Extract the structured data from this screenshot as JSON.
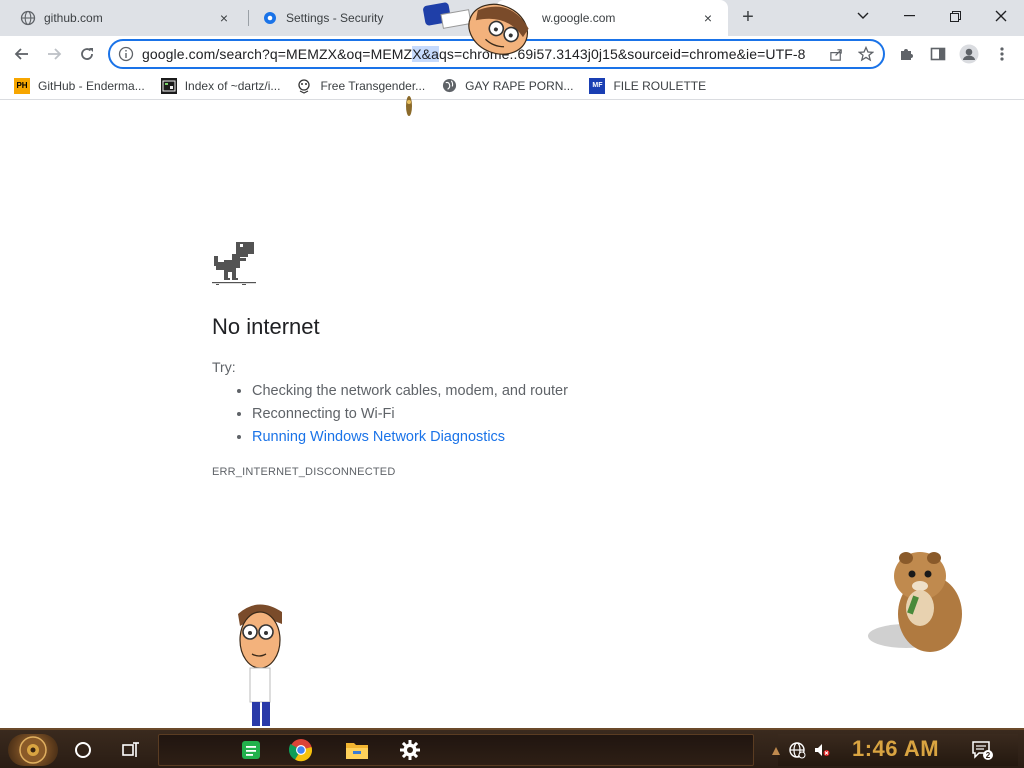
{
  "tabs": [
    {
      "title": "github.com",
      "close": "×"
    },
    {
      "title": "Settings - Security",
      "close": "×"
    },
    {
      "title": "w.google.com",
      "close": "×"
    }
  ],
  "new_tab_label": "+",
  "window_controls": {
    "dropdown": "⌄",
    "minimize": "—",
    "maximize": "❐",
    "close": "✕"
  },
  "omnibox": {
    "url_before": "google.com/search?q=MEMZX&oq=MEMZ",
    "url_selected": "X&a",
    "url_after": "qs=chrome..69i57.3143j0j15&sourceid=chrome&ie=UTF-8"
  },
  "bookmarks": [
    {
      "label": "GitHub - Enderma...",
      "icon": "ph-logo-icon",
      "icon_text": "PH"
    },
    {
      "label": "Index of ~dartz/i...",
      "icon": "folder-icon",
      "icon_text": ""
    },
    {
      "label": "Free Transgender...",
      "icon": "mascot-icon",
      "icon_text": ""
    },
    {
      "label": "GAY RAPE PORN...",
      "icon": "globe-icon",
      "icon_text": ""
    },
    {
      "label": "FILE ROULETTE",
      "icon": "file-roulette-icon",
      "icon_text": "MF"
    }
  ],
  "page": {
    "heading": "No internet",
    "try_label": "Try:",
    "suggestions": [
      "Checking the network cables, modem, and router",
      "Reconnecting to Wi-Fi",
      "Running Windows Network Diagnostics"
    ],
    "error_code": "ERR_INTERNET_DISCONNECTED"
  },
  "taskbar": {
    "clock": "1:46 AM",
    "notification_count": "2"
  },
  "colors": {
    "accent": "#1a73e8",
    "tab_strip": "#dee1e6",
    "taskbar": "#2a1d14",
    "clock": "#d9a441"
  }
}
